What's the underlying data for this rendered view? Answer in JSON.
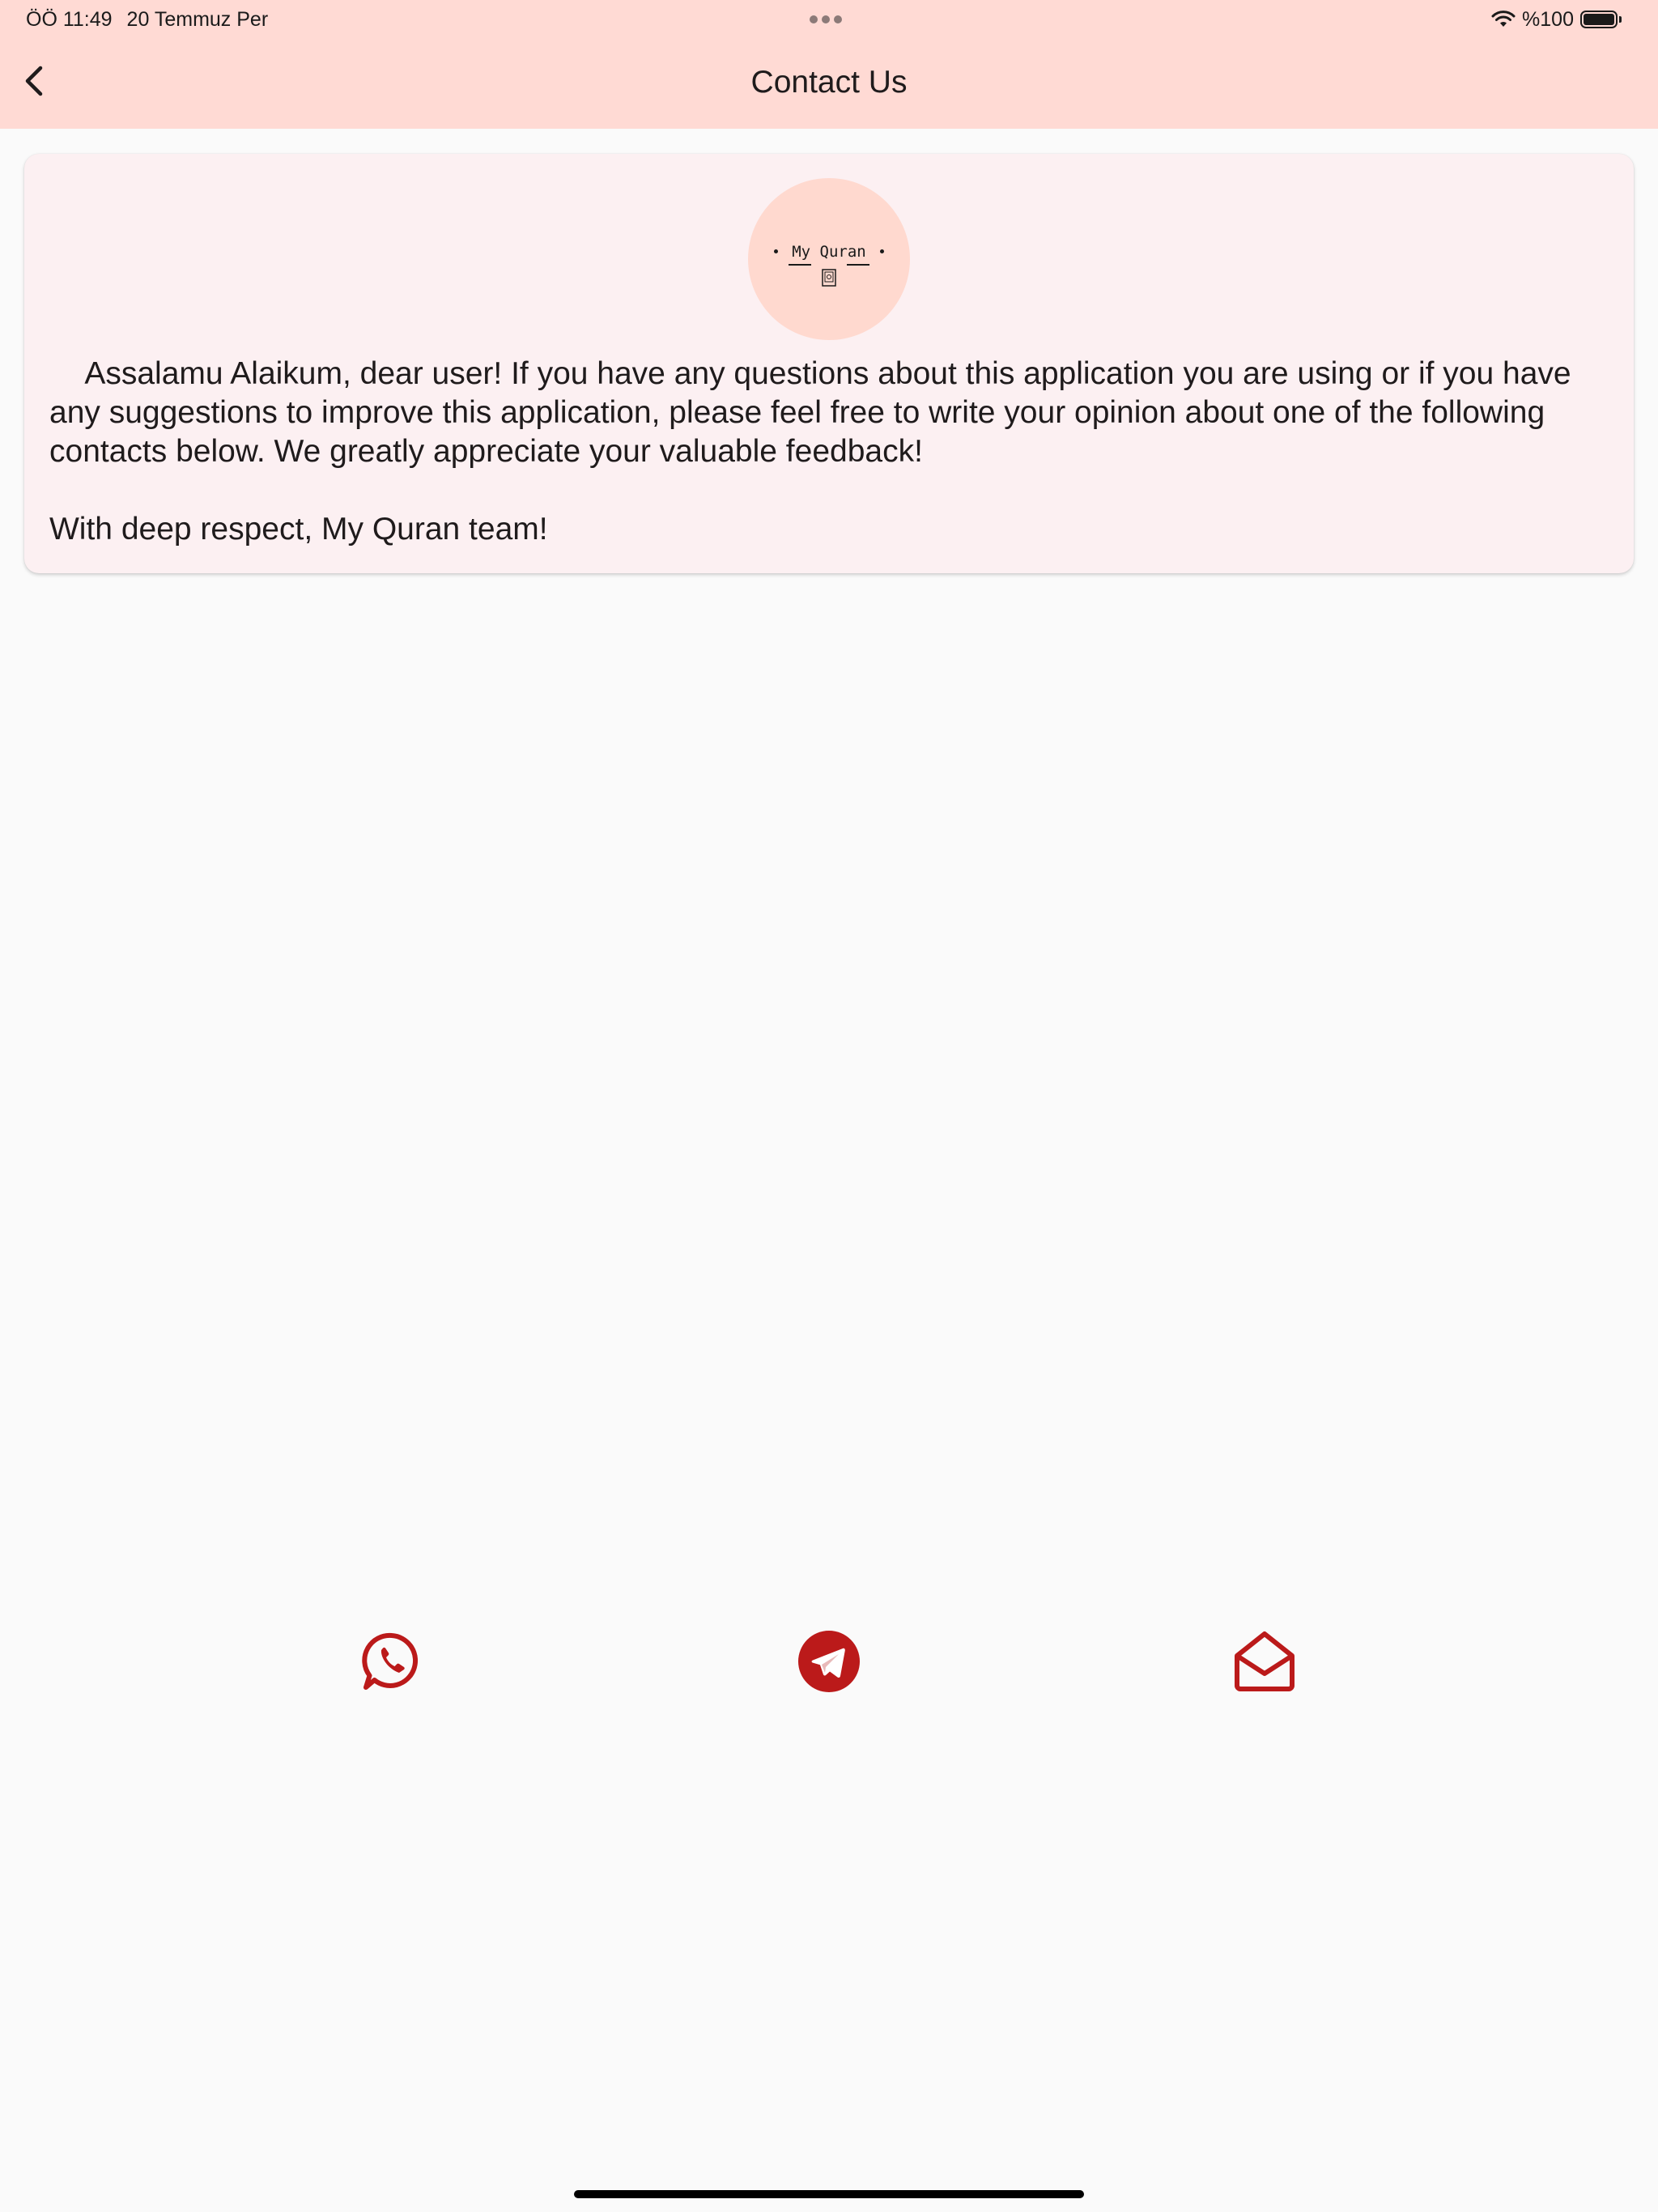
{
  "status_bar": {
    "time": "ÖÖ 11:49",
    "date": "20 Temmuz Per",
    "battery": "%100",
    "battery_level": 1.0,
    "icons": [
      "wifi-icon",
      "battery-icon"
    ]
  },
  "header": {
    "title": "Contact Us",
    "back_icon": "chevron-left-icon",
    "background": "#ffdad4"
  },
  "card": {
    "logo_text": "My Quran",
    "message": "    Assalamu Alaikum, dear user! If you have any questions about this application you are using or if you have any suggestions to improve this application, please feel free to write your opinion about one of the following contacts below. We greatly appreciate your valuable feedback!\n\nWith deep respect, My Quran team!",
    "background": "#fcf0f2"
  },
  "contacts": [
    {
      "icon": "whatsapp-icon"
    },
    {
      "icon": "telegram-icon"
    },
    {
      "icon": "email-open-icon"
    }
  ],
  "colors": {
    "accent": "#bb1a1a",
    "page_background": "#fafafa",
    "logo_circle": "#ffd9cf"
  }
}
